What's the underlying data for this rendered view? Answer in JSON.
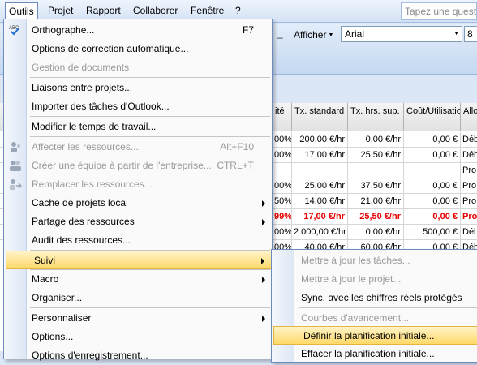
{
  "menubar": {
    "items": [
      "Outils",
      "Projet",
      "Rapport",
      "Collaborer",
      "Fenêtre",
      "?"
    ],
    "help_placeholder": "Tapez une questi"
  },
  "toolbar": {
    "show_label": "Afficher",
    "font": "Arial",
    "font_size": "8"
  },
  "grid": {
    "headers": [
      "ité",
      "Tx. standard",
      "Tx. hrs. sup.",
      "Coût/Utilisation",
      "Allo"
    ],
    "rows": [
      {
        "pct": "00%",
        "std": "200,00 €/hr",
        "ot": "0,00 €/hr",
        "cost": "0,00 €",
        "acc": "Déb",
        "red": false
      },
      {
        "pct": "00%",
        "std": "17,00 €/hr",
        "ot": "25,50 €/hr",
        "cost": "0,00 €",
        "acc": "Déb",
        "red": false
      },
      {
        "pct": "",
        "std": "",
        "ot": "",
        "cost": "",
        "acc": "Pro",
        "red": false
      },
      {
        "pct": "00%",
        "std": "25,00 €/hr",
        "ot": "37,50 €/hr",
        "cost": "0,00 €",
        "acc": "Pro",
        "red": false
      },
      {
        "pct": "50%",
        "std": "14,00 €/hr",
        "ot": "21,00 €/hr",
        "cost": "0,00 €",
        "acc": "Pro",
        "red": false
      },
      {
        "pct": "99%",
        "std": "17,00 €/hr",
        "ot": "25,50 €/hr",
        "cost": "0,00 €",
        "acc": "Pro",
        "red": true
      },
      {
        "pct": "00%",
        "std": "2 000,00 €/hr",
        "ot": "0,00 €/hr",
        "cost": "500,00 €",
        "acc": "Déb",
        "red": false
      },
      {
        "pct": "00%",
        "std": "40,00 €/hr",
        "ot": "60,00 €/hr",
        "cost": "0,00 €",
        "acc": "Déb",
        "red": false
      }
    ]
  },
  "tools_menu": {
    "items": [
      {
        "label": "Orthographe...",
        "shortcut": "F7"
      },
      {
        "label": "Options de correction automatique..."
      },
      {
        "label": "Gestion de documents"
      },
      {
        "label": "Liaisons entre projets..."
      },
      {
        "label": "Importer des tâches d'Outlook..."
      },
      {
        "label": "Modifier le temps de travail..."
      },
      {
        "label": "Affecter les ressources...",
        "shortcut": "Alt+F10"
      },
      {
        "label": "Créer une équipe à partir de l'entreprise...",
        "shortcut": "CTRL+T"
      },
      {
        "label": "Remplacer les ressources..."
      },
      {
        "label": "Cache de projets local"
      },
      {
        "label": "Partage des ressources"
      },
      {
        "label": "Audit des ressources..."
      },
      {
        "label": "Suivi"
      },
      {
        "label": "Macro"
      },
      {
        "label": "Organiser..."
      },
      {
        "label": "Personnaliser"
      },
      {
        "label": "Options..."
      },
      {
        "label": "Options d'enregistrement..."
      }
    ]
  },
  "track_menu": {
    "items": [
      {
        "label": "Mettre à jour les tâches..."
      },
      {
        "label": "Mettre à jour le projet..."
      },
      {
        "label": "Sync. avec les chiffres réels protégés"
      },
      {
        "label": "Courbes d'avancement..."
      },
      {
        "label": "Définir la planification initiale..."
      },
      {
        "label": "Effacer la planification initiale..."
      }
    ]
  },
  "colors": {
    "highlight": "#ffd96a",
    "overallocated": "#e60000",
    "menubar": "#d4e2f5"
  },
  "icons": [
    "spelling-icon",
    "assign-resources-icon",
    "build-team-icon",
    "replace-resources-icon",
    "submenu-arrow-icon"
  ]
}
